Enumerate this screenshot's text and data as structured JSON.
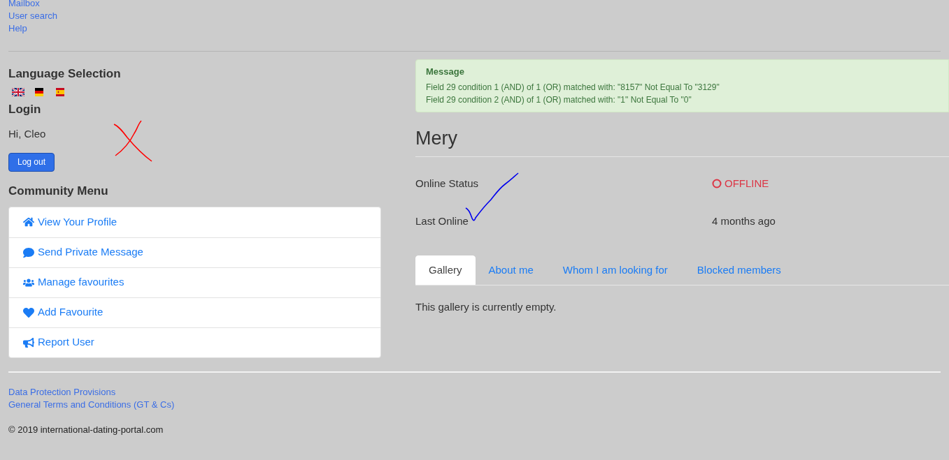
{
  "nav_links": [
    "Mailbox",
    "User search",
    "Help"
  ],
  "language_selection": {
    "title": "Language Selection",
    "flags": [
      {
        "kind": "uk"
      },
      {
        "kind": "de"
      },
      {
        "kind": "es"
      }
    ]
  },
  "login": {
    "title": "Login",
    "greeting": "Hi, Cleo",
    "button": "Log out"
  },
  "community_menu": {
    "title": "Community Menu",
    "items": [
      {
        "label": "View Your Profile",
        "kind": "home"
      },
      {
        "label": "Send Private Message",
        "kind": "message"
      },
      {
        "label": "Manage favourites",
        "kind": "users"
      },
      {
        "label": "Add Favourite",
        "kind": "heart"
      },
      {
        "label": "Report User",
        "kind": "report"
      }
    ]
  },
  "message": {
    "title": "Message",
    "lines": [
      "Field 29 condition 1 (AND) of 1 (OR) matched with: \"8157\" Not Equal To \"3129\"",
      "Field 29 condition 2 (AND) of 1 (OR) matched with: \"1\" Not Equal To \"0\""
    ]
  },
  "profile": {
    "name": "Mery",
    "fields": [
      {
        "label": "Online Status",
        "value": "OFFLINE",
        "kind": "status"
      },
      {
        "label": "Last Online",
        "value": "4 months ago",
        "kind": "text"
      }
    ]
  },
  "tabs": [
    {
      "label": "Gallery",
      "selected": true
    },
    {
      "label": "About me",
      "selected": false
    },
    {
      "label": "Whom I am looking for",
      "selected": false
    },
    {
      "label": "Blocked members",
      "selected": false
    }
  ],
  "tab_content": "This gallery is currently empty.",
  "footer": {
    "links": [
      "Data Protection Provisions",
      "General Terms and Conditions (GT & Cs)"
    ],
    "copyright": "© 2019 international-dating-portal.com"
  }
}
